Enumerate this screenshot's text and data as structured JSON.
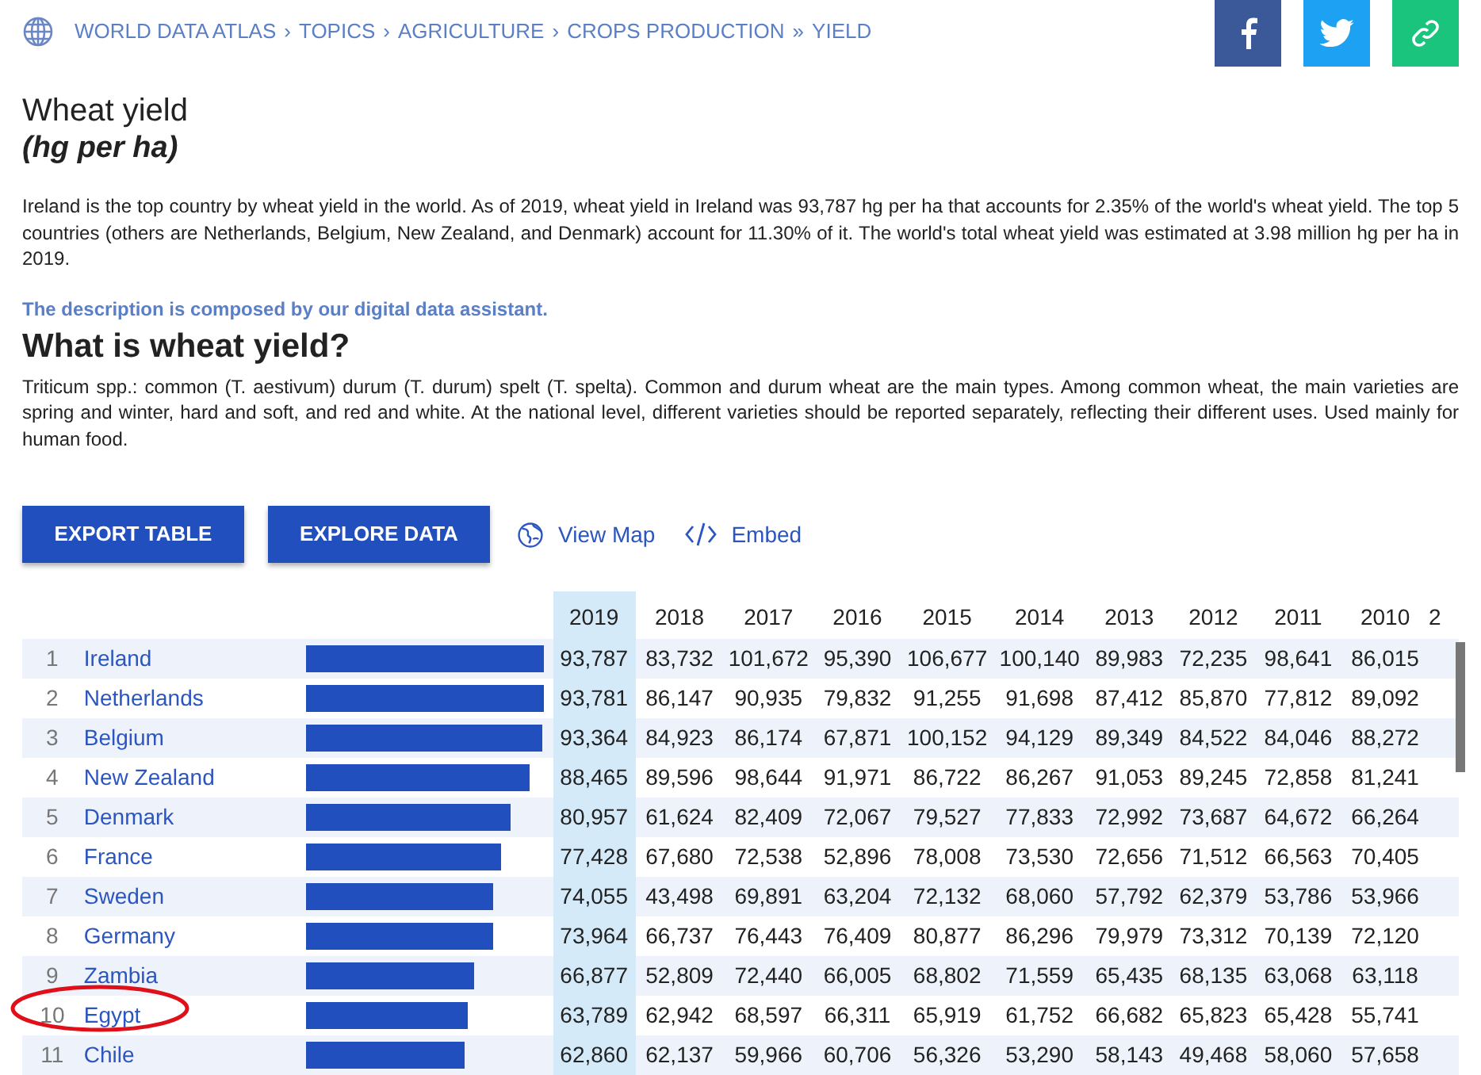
{
  "breadcrumb": [
    {
      "label": "WORLD DATA ATLAS",
      "separator": "›"
    },
    {
      "label": "TOPICS",
      "separator": "›"
    },
    {
      "label": "AGRICULTURE",
      "separator": "›"
    },
    {
      "label": "CROPS PRODUCTION",
      "separator": "»"
    },
    {
      "label": "YIELD"
    }
  ],
  "share_buttons": [
    {
      "kind": "facebook"
    },
    {
      "kind": "twitter"
    },
    {
      "kind": "link"
    }
  ],
  "title": "Wheat yield",
  "unit": "(hg per ha)",
  "description": "Ireland is the top country by wheat yield in the world. As of 2019, wheat yield in Ireland was 93,787 hg per ha that accounts for 2.35% of the world's wheat yield. The top 5 countries (others are Netherlands, Belgium, New Zealand, and Denmark) account for 11.30% of it. The world's total wheat yield was estimated at 3.98 million hg per ha in 2019.",
  "assistant_note": "The description is composed by our digital data assistant.",
  "section_heading": "What is wheat yield?",
  "definition": "Triticum spp.: common (T. aestivum) durum (T. durum) spelt (T. spelta). Common and durum wheat are the main types. Among common wheat, the main varieties are spring and winter, hard and soft, and red and white. At the national level, different varieties should be reported separately, reflecting their different uses. Used mainly for human food.",
  "buttons": [
    "EXPORT TABLE",
    "EXPLORE DATA"
  ],
  "links": [
    {
      "kind": "map",
      "label": "View Map"
    },
    {
      "kind": "embed",
      "label": "Embed"
    }
  ],
  "table": {
    "columns": [
      {
        "label": "2019",
        "selected": true
      },
      {
        "label": "2018",
        "selected": false
      },
      {
        "label": "2017",
        "selected": false
      },
      {
        "label": "2016",
        "selected": false
      },
      {
        "label": "2015",
        "selected": false
      },
      {
        "label": "2014",
        "selected": false
      },
      {
        "label": "2013",
        "selected": false
      },
      {
        "label": "2012",
        "selected": false
      },
      {
        "label": "2011",
        "selected": false
      },
      {
        "label": "2010",
        "selected": false
      },
      {
        "label": "2",
        "selected": false
      }
    ],
    "rows": [
      {
        "rank": "1",
        "country": "Ireland",
        "level": 1.0,
        "values": [
          "93,787",
          "83,732",
          "101,672",
          "95,390",
          "106,677",
          "100,140",
          "89,983",
          "72,235",
          "98,641",
          "86,015"
        ]
      },
      {
        "rank": "2",
        "country": "Netherlands",
        "level": 1.0,
        "values": [
          "93,781",
          "86,147",
          "90,935",
          "79,832",
          "91,255",
          "91,698",
          "87,412",
          "85,870",
          "77,812",
          "89,092"
        ]
      },
      {
        "rank": "3",
        "country": "Belgium",
        "level": 0.995,
        "values": [
          "93,364",
          "84,923",
          "86,174",
          "67,871",
          "100,152",
          "94,129",
          "89,349",
          "84,522",
          "84,046",
          "88,272"
        ]
      },
      {
        "rank": "4",
        "country": "New Zealand",
        "level": 0.943,
        "values": [
          "88,465",
          "89,596",
          "98,644",
          "91,971",
          "86,722",
          "86,267",
          "91,053",
          "89,245",
          "72,858",
          "81,241"
        ]
      },
      {
        "rank": "5",
        "country": "Denmark",
        "level": 0.863,
        "values": [
          "80,957",
          "61,624",
          "82,409",
          "72,067",
          "79,527",
          "77,833",
          "72,992",
          "73,687",
          "64,672",
          "66,264"
        ]
      },
      {
        "rank": "6",
        "country": "France",
        "level": 0.826,
        "values": [
          "77,428",
          "67,680",
          "72,538",
          "52,896",
          "78,008",
          "73,530",
          "72,656",
          "71,512",
          "66,563",
          "70,405"
        ]
      },
      {
        "rank": "7",
        "country": "Sweden",
        "level": 0.79,
        "values": [
          "74,055",
          "43,498",
          "69,891",
          "63,204",
          "72,132",
          "68,060",
          "57,792",
          "62,379",
          "53,786",
          "53,966"
        ]
      },
      {
        "rank": "8",
        "country": "Germany",
        "level": 0.789,
        "values": [
          "73,964",
          "66,737",
          "76,443",
          "76,409",
          "80,877",
          "86,296",
          "79,979",
          "73,312",
          "70,139",
          "72,120"
        ]
      },
      {
        "rank": "9",
        "country": "Zambia",
        "level": 0.713,
        "values": [
          "66,877",
          "52,809",
          "72,440",
          "66,005",
          "68,802",
          "71,559",
          "65,435",
          "68,135",
          "63,068",
          "63,118"
        ]
      },
      {
        "rank": "10",
        "country": "Egypt",
        "level": 0.68,
        "values": [
          "63,789",
          "62,942",
          "68,597",
          "66,311",
          "65,919",
          "61,752",
          "66,682",
          "65,823",
          "65,428",
          "55,741"
        ]
      },
      {
        "rank": "11",
        "country": "Chile",
        "level": 0.67,
        "values": [
          "62,860",
          "62,137",
          "59,966",
          "60,706",
          "56,326",
          "53,290",
          "58,143",
          "49,468",
          "58,060",
          "57,658"
        ]
      }
    ]
  }
}
